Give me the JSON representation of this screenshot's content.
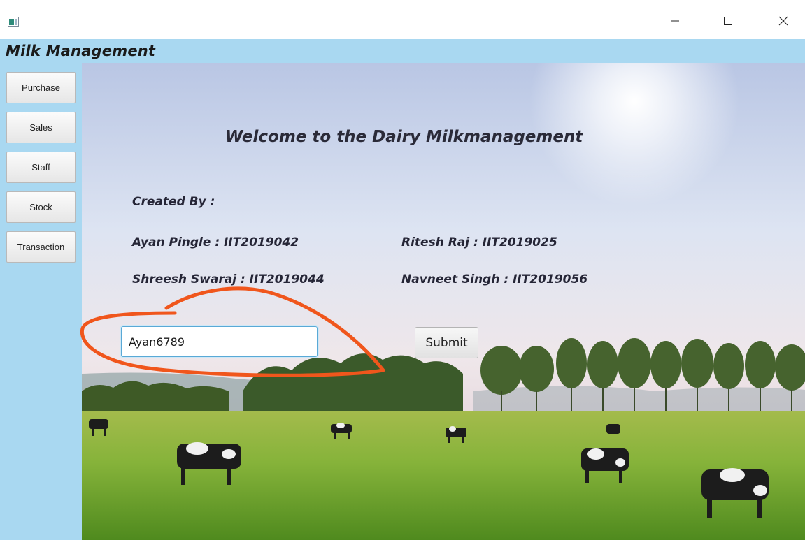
{
  "window": {
    "minimize_symbol": "—",
    "maximize_symbol": "☐",
    "close_symbol": "✕"
  },
  "app": {
    "title": "Milk Management"
  },
  "sidebar": {
    "items": [
      {
        "label": "Purchase"
      },
      {
        "label": "Sales"
      },
      {
        "label": "Staff"
      },
      {
        "label": "Stock"
      },
      {
        "label": "Transaction"
      }
    ]
  },
  "main": {
    "welcome": "Welcome to the Dairy Milkmanagement",
    "created_by": "Created By :",
    "authors": [
      "Ayan Pingle : IIT2019042",
      "Ritesh Raj : IIT2019025",
      "Shreesh Swaraj : IIT2019044",
      "Navneet Singh : IIT2019056"
    ],
    "input_value": "Ayan6789",
    "submit_label": "Submit"
  },
  "colors": {
    "sidebar_bg": "#a9d8f1",
    "annotation": "#f0561c",
    "input_focus": "#5aa9d6"
  },
  "icons": [
    "app-icon",
    "minimize-icon",
    "maximize-icon",
    "close-icon"
  ]
}
